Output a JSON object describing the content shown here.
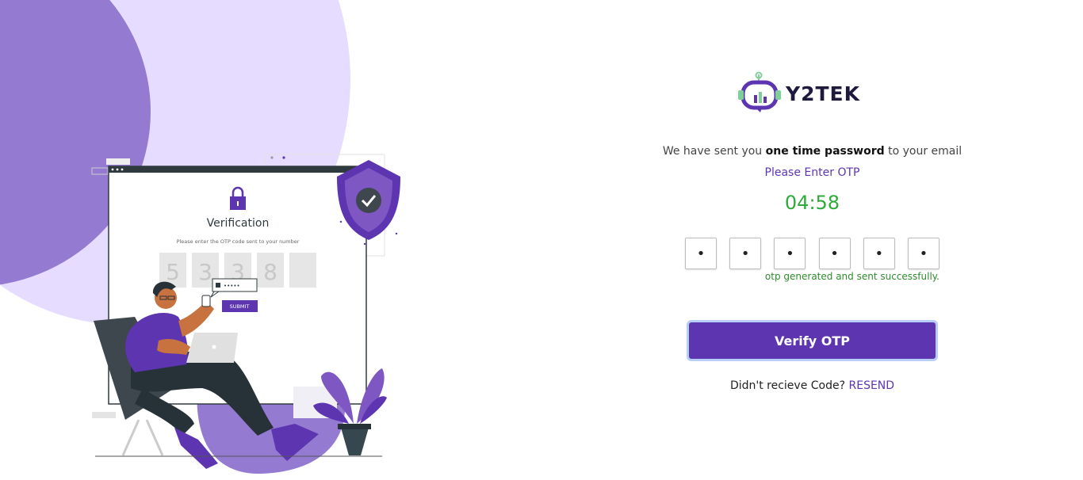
{
  "illustration": {
    "card_title": "Verification",
    "card_subtitle": "Please enter the OTP code sent to your number",
    "code_digits": [
      "5",
      "3",
      "3",
      "8",
      ""
    ],
    "password_mask": "•••••",
    "submit_label": "SUBMIT"
  },
  "brand": {
    "name": "Y2TEK",
    "accent_color": "#5e35b1"
  },
  "message": {
    "prefix": "We have sent you",
    "highlight": "one time password",
    "suffix": "to your email"
  },
  "prompt": "Please Enter OTP",
  "timer": "04:58",
  "otp": {
    "digits": [
      "•",
      "•",
      "•",
      "•",
      "•",
      "•"
    ],
    "status": "otp generated and sent successfully."
  },
  "verify_button": "Verify OTP",
  "resend": {
    "question": "Didn't recieve Code?",
    "link": "RESEND"
  }
}
